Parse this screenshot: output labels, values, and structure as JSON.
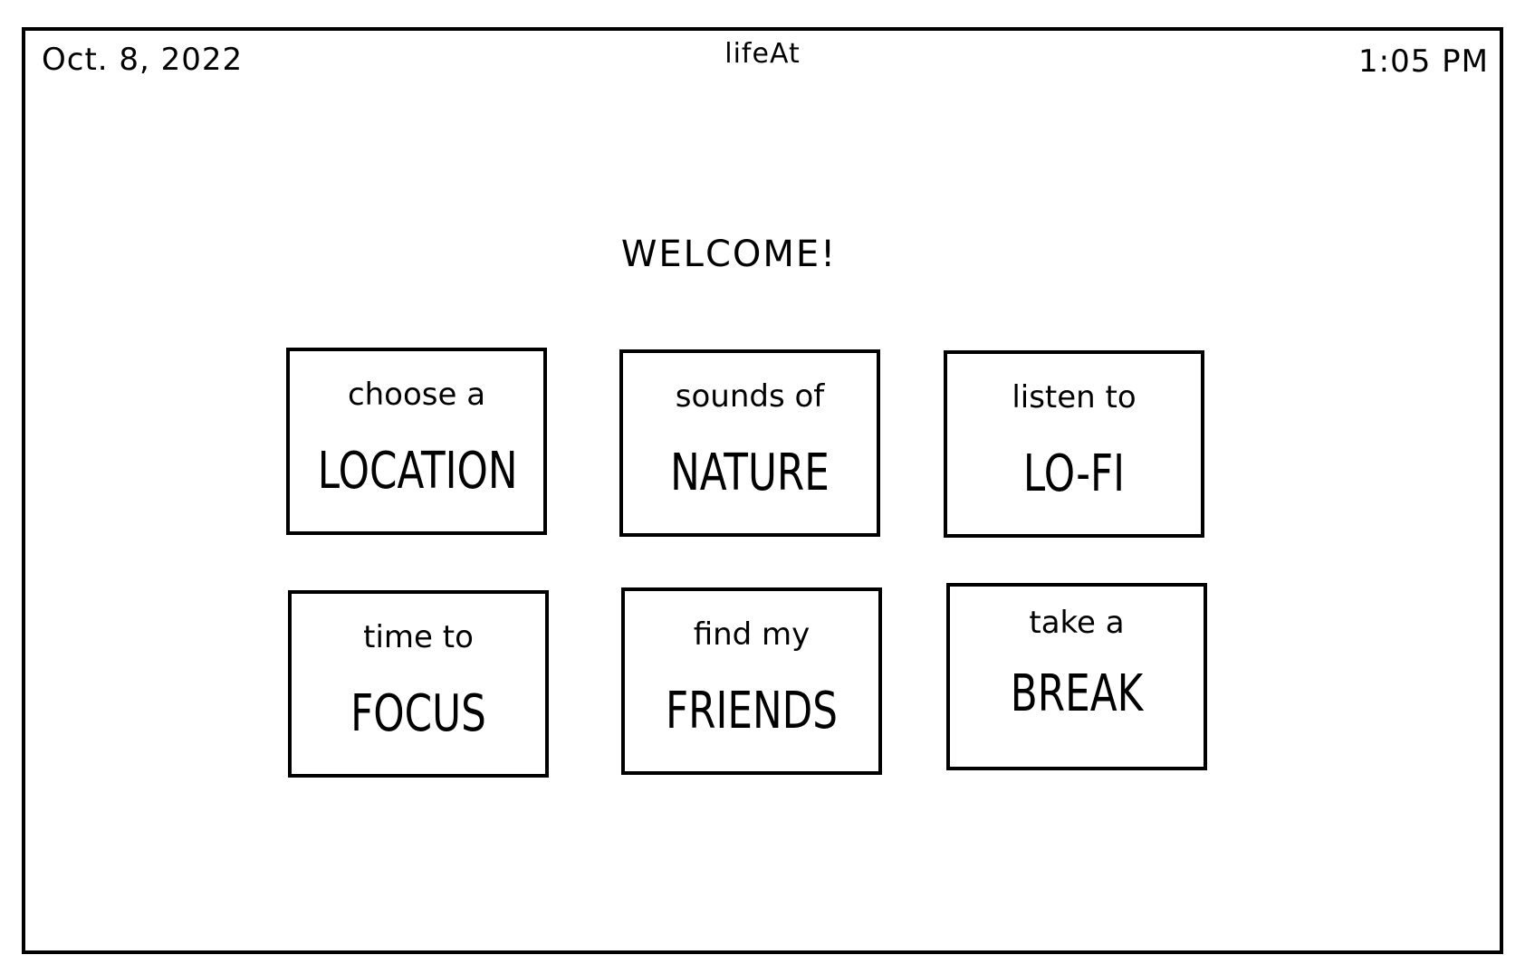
{
  "status_bar": {
    "date": "Oct. 8, 2022",
    "app_name": "lifeAt",
    "time": "1:05 PM"
  },
  "welcome": "WELCOME!",
  "cards": [
    {
      "small": "choose a",
      "big": "LOCATION"
    },
    {
      "small": "sounds of",
      "big": "NATURE"
    },
    {
      "small": "listen to",
      "big": "LO-FI"
    },
    {
      "small": "time to",
      "big": "FOCUS"
    },
    {
      "small": "find my",
      "big": "FRIENDS"
    },
    {
      "small": "take a",
      "big": "BREAK"
    }
  ]
}
